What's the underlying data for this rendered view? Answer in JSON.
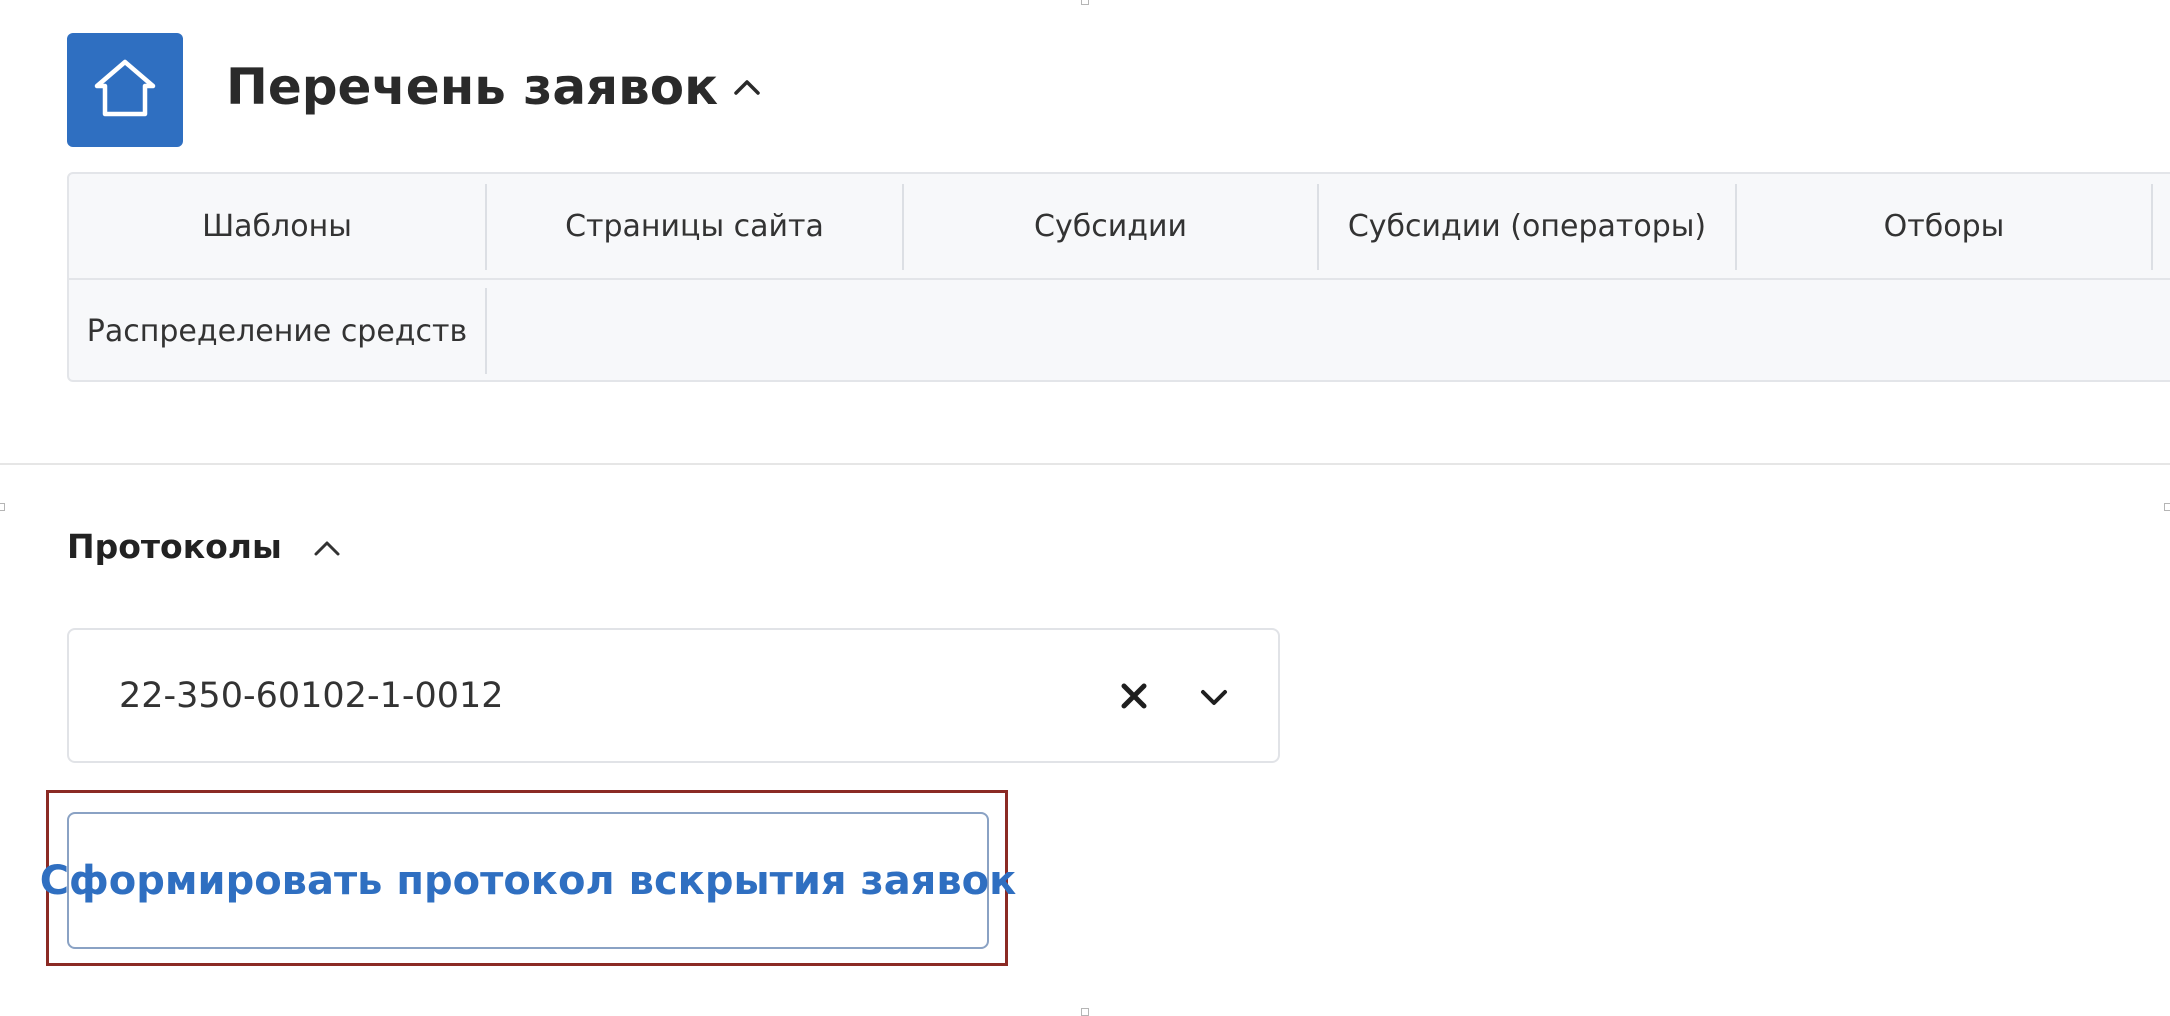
{
  "header": {
    "title": "Перечень заявок",
    "home_icon": "home-icon",
    "title_toggle_icon": "chevron-up-icon"
  },
  "tabs": [
    {
      "label": "Шаблоны"
    },
    {
      "label": "Страницы сайта"
    },
    {
      "label": "Субсидии"
    },
    {
      "label": "Субсидии (операторы)"
    },
    {
      "label": "Отборы"
    },
    {
      "label": "Распределение средств"
    }
  ],
  "protocols": {
    "title": "Протоколы",
    "toggle_icon": "chevron-up-icon",
    "select": {
      "value": "22-350-60102-1-0012",
      "clear_icon": "close-icon",
      "dropdown_icon": "chevron-down-icon"
    },
    "action_label": "Сформировать протокол вскрытия заявок"
  },
  "colors": {
    "accent": "#2f6fc1",
    "highlight_border": "#8b2a24",
    "panel_bg": "#f7f8fa"
  }
}
